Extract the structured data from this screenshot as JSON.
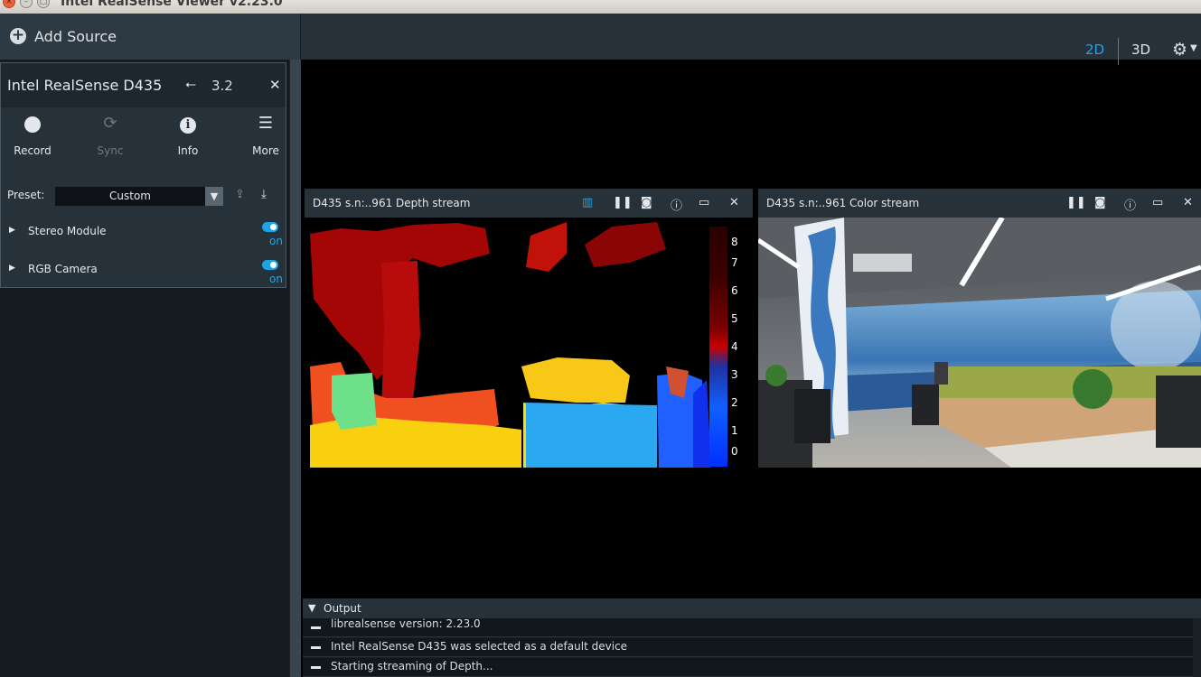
{
  "window": {
    "title": "Intel RealSense Viewer v2.23.0"
  },
  "toolbar": {
    "add_source": "Add Source",
    "mode_2d": "2D",
    "mode_3d": "3D"
  },
  "device": {
    "name": "Intel RealSense D435",
    "usb": "3.2",
    "tools": [
      {
        "label": "Record",
        "icon": "record-icon",
        "enabled": true
      },
      {
        "label": "Sync",
        "icon": "sync-icon",
        "enabled": false
      },
      {
        "label": "Info",
        "icon": "info-icon",
        "enabled": true
      },
      {
        "label": "More",
        "icon": "menu-icon",
        "enabled": true
      }
    ],
    "preset_label": "Preset:",
    "preset_value": "Custom",
    "modules": [
      {
        "label": "Stereo Module",
        "state": "on"
      },
      {
        "label": "RGB Camera",
        "state": "on"
      }
    ]
  },
  "streams": {
    "depth": {
      "title": "D435 s.n:..961 Depth stream",
      "legend": [
        "8",
        "7",
        "6",
        "5",
        "4",
        "3",
        "2",
        "1",
        "0"
      ]
    },
    "color": {
      "title": "D435 s.n:..961 Color stream"
    }
  },
  "output": {
    "label": "Output",
    "lines": [
      "librealsense version: 2.23.0",
      "Intel RealSense D435 was selected as a default device",
      "Starting streaming of Depth..."
    ]
  },
  "colors": {
    "accent": "#1ea3e6",
    "panel": "#27313a",
    "sidebar": "#141a1f"
  }
}
